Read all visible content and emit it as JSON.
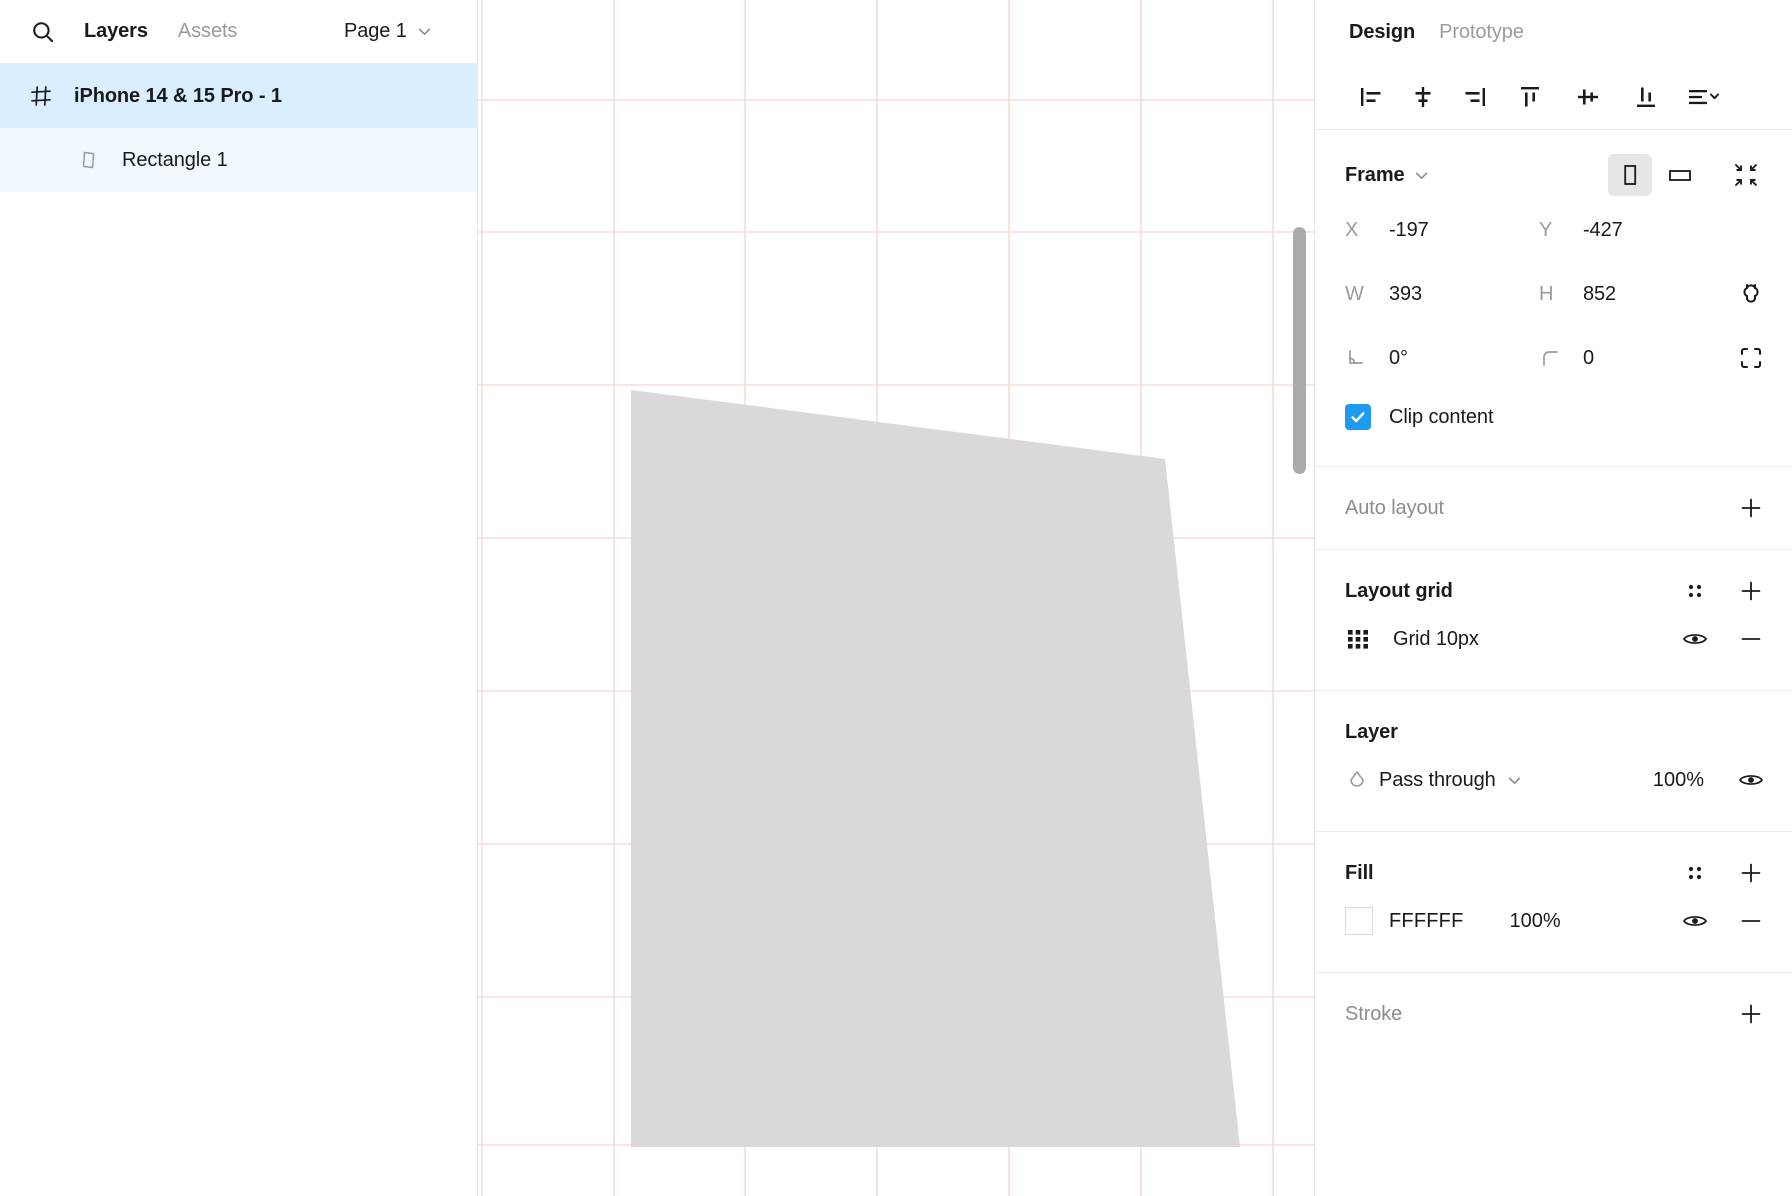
{
  "left_panel": {
    "search_icon": "search-icon",
    "tabs": [
      {
        "label": "Layers",
        "active": true
      },
      {
        "label": "Assets",
        "active": false
      }
    ],
    "page_selector": {
      "label": "Page 1",
      "chevron": "chevron-down-icon"
    },
    "layers": [
      {
        "name": "iPhone 14 & 15 Pro - 1",
        "icon": "frame-icon",
        "depth": 0,
        "selected": true
      },
      {
        "name": "Rectangle 1",
        "icon": "vector-shape-icon",
        "depth": 1,
        "selected": true
      }
    ]
  },
  "canvas": {
    "grid_color": "#FADBD8",
    "shape_fill": "#D9D9D9",
    "scrollbar": "vertical-scrollbar"
  },
  "right_panel": {
    "tabs": [
      {
        "label": "Design",
        "active": true
      },
      {
        "label": "Prototype",
        "active": false
      }
    ],
    "align_buttons": [
      "align-left-icon",
      "align-horizontal-center-icon",
      "align-right-icon",
      "align-top-icon",
      "align-vertical-center-icon",
      "align-bottom-icon",
      "distribute-menu-icon"
    ],
    "frame": {
      "title": "Frame",
      "chevron": "chevron-down-icon",
      "orientation": {
        "portrait": "portrait-icon",
        "landscape": "landscape-icon",
        "active": "portrait"
      },
      "resize_icon": "resize-to-fit-icon",
      "x_key": "X",
      "x_value": "-197",
      "y_key": "Y",
      "y_value": "-427",
      "w_key": "W",
      "w_value": "393",
      "h_key": "H",
      "h_value": "852",
      "constrain_icon": "constrain-proportions-icon",
      "rotation_icon": "rotation-icon",
      "rotation_value": "0°",
      "corner_icon": "corner-radius-icon",
      "corner_value": "0",
      "independent_corners_icon": "independent-corners-icon",
      "clip_content_label": "Clip content",
      "clip_content_checked": true,
      "checkbox_color": "#1E9BF0"
    },
    "auto_layout": {
      "title": "Auto layout",
      "add_icon": "plus-icon"
    },
    "layout_grid": {
      "title": "Layout grid",
      "settings_icon": "grid-settings-icon",
      "add_icon": "plus-icon",
      "items": [
        {
          "icon": "grid-dots-icon",
          "label": "Grid 10px",
          "visibility_icon": "eye-icon",
          "remove_icon": "minus-icon"
        }
      ]
    },
    "layer": {
      "title": "Layer",
      "blend_icon": "blend-mode-icon",
      "blend_mode": "Pass through",
      "chevron": "chevron-down-icon",
      "opacity": "100%",
      "visibility_icon": "eye-icon"
    },
    "fill": {
      "title": "Fill",
      "settings_icon": "fill-settings-icon",
      "add_icon": "plus-icon",
      "items": [
        {
          "swatch_color": "#FFFFFF",
          "hex": "FFFFFF",
          "opacity": "100%",
          "visibility_icon": "eye-icon",
          "remove_icon": "minus-icon"
        }
      ]
    },
    "stroke": {
      "title": "Stroke",
      "add_icon": "plus-icon"
    }
  }
}
